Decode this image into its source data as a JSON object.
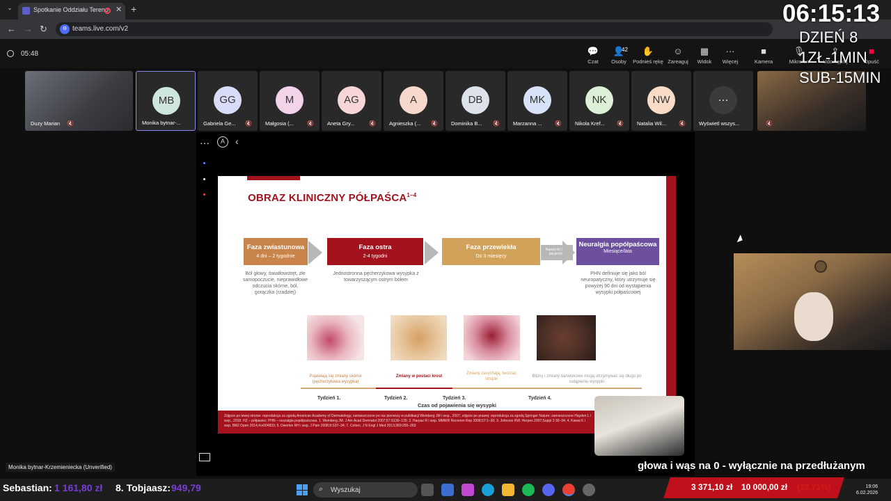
{
  "browser": {
    "tab_title": "Spotkanie Oddziału Tereno",
    "url": "teams.live.com/v2"
  },
  "meeting": {
    "elapsed": "05:48",
    "toolbar": [
      {
        "label": "Czat",
        "icon": "chat-icon"
      },
      {
        "label": "Osoby",
        "icon": "people-icon",
        "count": "42"
      },
      {
        "label": "Podnieś rękę",
        "icon": "hand-icon"
      },
      {
        "label": "Zareaguj",
        "icon": "emoji-icon"
      },
      {
        "label": "Widok",
        "icon": "grid-icon"
      },
      {
        "label": "Więcej",
        "icon": "more-icon"
      },
      {
        "label": "Kamera",
        "icon": "camera-icon"
      },
      {
        "label": "Mikrofon",
        "icon": "mic-icon"
      },
      {
        "label": "Udostępnij",
        "icon": "share-icon"
      },
      {
        "label": "Opuść",
        "icon": "leave-icon"
      }
    ],
    "participants": [
      {
        "name": "Duzy Marian",
        "initials": "",
        "color": ""
      },
      {
        "name": "Monika bytnar-...",
        "initials": "MB",
        "color": "#cfe6e0"
      },
      {
        "name": "Gabriela Ge...",
        "initials": "GG",
        "color": "#d9dcf6"
      },
      {
        "name": "Małgosia (...",
        "initials": "M",
        "color": "#f2d3ea"
      },
      {
        "name": "Aneta Gry...",
        "initials": "AG",
        "color": "#f6d6d6"
      },
      {
        "name": "Agnieszka (...",
        "initials": "A",
        "color": "#f6d8cc"
      },
      {
        "name": "Dominika B...",
        "initials": "DB",
        "color": "#dde2ea"
      },
      {
        "name": "Marzanna ...",
        "initials": "MK",
        "color": "#d6e3f6"
      },
      {
        "name": "Nikola Kref...",
        "initials": "NK",
        "color": "#dbf0d6"
      },
      {
        "name": "Natalia Wil...",
        "initials": "NW",
        "color": "#f8dcc8"
      },
      {
        "name": "Wyświetl wszys...",
        "initials": "···",
        "color": "#3b3b3b"
      }
    ],
    "presenter_label": "Monika bytnar-Krzemieniecka (Unverified)"
  },
  "slide": {
    "title": "OBRAZ KLINICZNY PÓŁPAŚCA",
    "title_sup": "1–4",
    "phases": [
      {
        "name": "Faza zwiastunowa",
        "duration": "4 dni – 2 tygodnie",
        "color": "#c8844a",
        "desc": "Ból głowy, światłowstręt, złe samopoczucie, nieprawidłowe odczucia skórne, ból, gorączka (rzadziej)"
      },
      {
        "name": "Faza ostra",
        "duration": "2-4 tygodni",
        "color": "#a3121d",
        "desc": "Jednostronna pęcherzykowa wysypka z towarzyszącym ostrym bólem"
      },
      {
        "name": "Faza przewlekła",
        "duration": "Do 3 miesięcy",
        "color": "#d3a25a",
        "desc": ""
      },
      {
        "name": "Neuralgia popółpaścowa",
        "duration": "Miesiące/lata",
        "color": "#6c4f9d",
        "desc": "PHN definiuje się jako ból neuropatyczny, który utrzymuje się powyżej 90 dni od wystąpienia wysypki półpaścowej"
      }
    ],
    "transition_note": "Nawet do 30% pacjentów",
    "captions": [
      "Pojawiają się zmiany skórne (pęcherzykowa wysypka)",
      "Zmiany w postaci krost",
      "Zmiany zasychają, tworzac strupki",
      "Blizny i zmiany barwnikowe mogą utrzymywać się długo po ustąpieniu wysypki"
    ],
    "weeks": [
      "Tydzień 1.",
      "Tydzień 2.",
      "Tydzień 3.",
      "Tydzień 4."
    ],
    "axis_label": "Czas od pojawienia się wysypki",
    "footnote": "Zdjęcie po lewej stronie: reprodukcja za zgodą American Academy of Dermatology; zamieszczone po raz pierwszy w publikacji Weinberg JM i wsp., 2007; zdjęcie po prawej: reprodukcja za zgodą Springer Nature; zamieszczone Hayden L i wsp., 2018. HZ – półpasiec; PHN – neuralgia popółpaścowa. 1. Weinberg JM. J Am Acad Dermatol 2007;57:S130–135; 2. Harpaz R i wsp. MMWR Recomm Rep 2008;57:1–30; 3. Johnson RW. Herpes 2007;Suppl 2:30–34; 4. Kawai K i wsp. BMJ Open 2014;4:e004833; 5. Dworkin RH i wsp. J Pain 2008;9:S37–34; 7. Cohen, J N Engl J Med 2013;369:255–263"
  },
  "overlay": {
    "clock": "06:15:13",
    "day": "DZIEŃ 8",
    "rate": "1ZŁ-1MIN",
    "sub": "SUB-15MIN",
    "ticker": "głowa i wąs na 0 - wyłącznie na przedłużanym",
    "donors": [
      {
        "name": "Sebastian:",
        "amount": "1 161,80 zł"
      },
      {
        "name": "8. Tobjaasz:",
        "amount": "949,79"
      }
    ],
    "goal": {
      "current": "3 371,10 zł",
      "target": "10 000,00 zł",
      "percent": "(33,71%)"
    }
  },
  "taskbar": {
    "search_placeholder": "Wyszukaj",
    "time": "19:06",
    "date": "6.02.2026"
  }
}
